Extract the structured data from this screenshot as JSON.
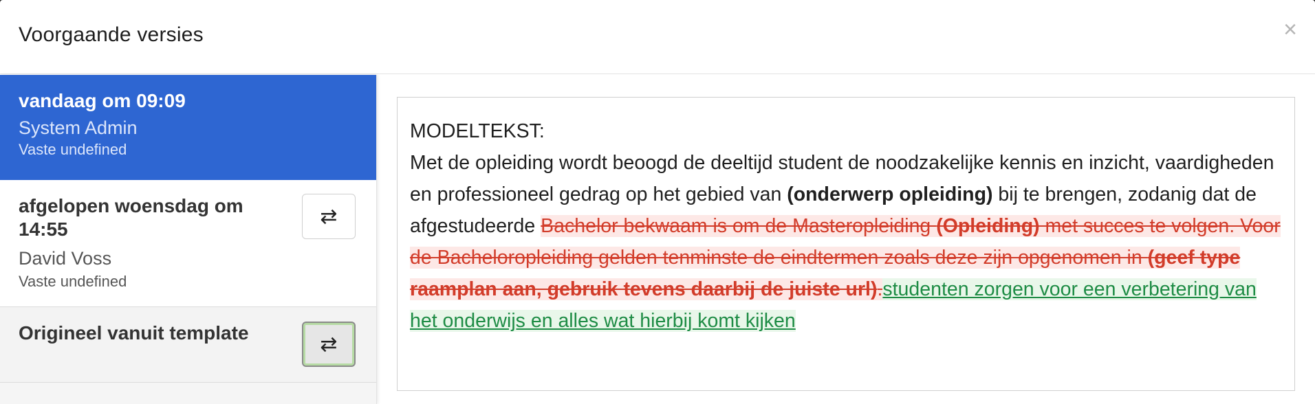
{
  "modal": {
    "title": "Voorgaande versies",
    "close_symbol": "×"
  },
  "versions": [
    {
      "date": "vandaag om 09:09",
      "user": "System Admin",
      "type": "Vaste undefined",
      "active": true
    },
    {
      "date": "afgelopen woensdag om 14:55",
      "user": "David Voss",
      "type": "Vaste undefined",
      "active": false
    },
    {
      "date": "Origineel vanuit template",
      "active": false
    }
  ],
  "compare_symbol": "⇄",
  "diff": {
    "heading": "MODELTEKST:",
    "intro": "Met de opleiding wordt beoogd de deeltijd student de noodzakelijke kennis en inzicht, vaardigheden en professioneel gedrag op het gebied van ",
    "bold1": "(onderwerp opleiding)",
    "mid": " bij te brengen, zodanig dat de afgestudeerde ",
    "del1": "Bachelor bekwaam is om de Masteropleiding ",
    "del_bold1": "(Opleiding)",
    "del2": " met succes te volgen. Voor de Bacheloropleiding gelden tenminste de eindtermen zoals deze zijn opgenomen in ",
    "del_bold2": "(geef type raamplan aan, gebruik tevens daarbij de juiste url)",
    "del3": ".",
    "ins1": "studenten zorgen voor een verbetering van het onderwijs en alles wat hierbij komt kijken"
  },
  "colors": {
    "active_bg": "#2e66d2",
    "deleted": "#d23c2a",
    "inserted": "#1e8c45"
  }
}
